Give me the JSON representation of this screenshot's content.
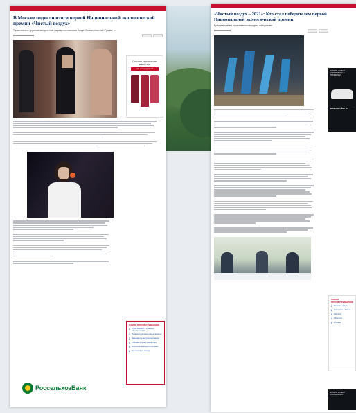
{
  "left_article": {
    "title": "В Москве подвели итоги первой Национальной экологической премии «Чистый воздух»",
    "lead": "Торжественное вручение авторитетной награды состоялось в Фонде «Росконгресс» на «Русское ...»",
    "ad": {
      "line1": "Сильные католические",
      "line2": "ваших вин",
      "cta": "Что нет на русском?"
    },
    "related_header": "САМОЕ ПРОСМАТРИВАЕМОЕ",
    "related": [
      {
        "n": "1",
        "t": "Путин объявил о снижении ключевой ставки"
      },
      {
        "n": "2",
        "t": "Минфин предложил новые правила"
      },
      {
        "n": "3",
        "t": "Нарышкин: ужесточение санкций"
      },
      {
        "n": "4",
        "t": "В Москве откроют новый парк"
      },
      {
        "n": "5",
        "t": "Результаты выборов в регионах"
      },
      {
        "n": "6",
        "t": "Как изменится погода"
      }
    ],
    "bank_name": "РоссельхозБанк"
  },
  "right_article": {
    "title": "«Чистый воздух – 2021»: Кто стал победителем первой Национальной экологической премии",
    "lead": "Вручение премии торжественно наградило победителей",
    "ad": {
      "header": "КУПИТЬ НОВЫЙ АВТОМОБИЛЬ С ПРОБЕГОМ",
      "cta": "ПРИЕЗЖАЙТЕ НА ..."
    },
    "related_header": "САМОЕ ПРОСМАТРИВАЕМОЕ",
    "related": [
      {
        "n": "1",
        "t": "Политика недели"
      },
      {
        "n": "2",
        "t": "Экономика и бизнес"
      },
      {
        "n": "3",
        "t": "Экология"
      },
      {
        "n": "4",
        "t": "Общество"
      },
      {
        "n": "5",
        "t": "Регионы"
      }
    ],
    "ad_bottom": "КУПИТЬ НОВЫЙ АВТОМОБИЛЬ"
  },
  "colors": {
    "accent": "#c8102e",
    "headline": "#0a2b5c",
    "bank": "#0a7a33"
  }
}
